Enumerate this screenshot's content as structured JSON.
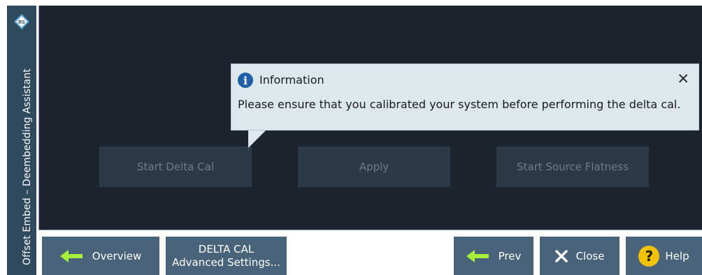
{
  "window": {
    "side_title": "Offset Embed – Deembedding Assistant",
    "logo_icon": "rohde-schwarz-logo-icon"
  },
  "main": {
    "buttons": {
      "start_delta_cal": "Start Delta Cal",
      "apply": "Apply",
      "start_source_flatness": "Start Source Flatness"
    }
  },
  "info_popup": {
    "icon": "info-icon",
    "title": "Information",
    "message": "Please ensure that you calibrated your system before performing the delta cal.",
    "close_icon": "close-icon"
  },
  "bottom_bar": {
    "overview_label": "Overview",
    "delta_cal_line1": "DELTA CAL",
    "delta_cal_line2": "Advanced Settings...",
    "prev_label": "Prev",
    "close_label": "Close",
    "help_label": "Help",
    "help_glyph": "?",
    "arrow_color": "#a6f23a",
    "help_color": "#f2c200"
  },
  "colors": {
    "panel_bg": "#1c2430",
    "strip_bg": "#2f4a5c",
    "bottom_button_bg": "#48637a",
    "popup_bg": "#dde8ee"
  }
}
